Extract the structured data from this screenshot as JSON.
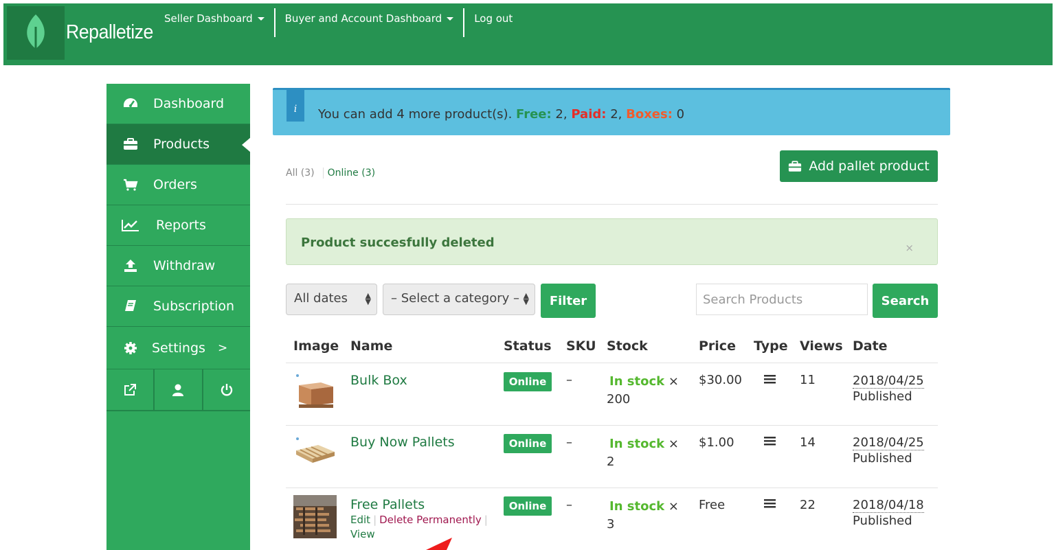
{
  "brand": "Repalletize",
  "topnav": {
    "seller": "Seller Dashboard",
    "buyer": "Buyer and Account Dashboard",
    "logout": "Log out"
  },
  "sidebar": {
    "items": [
      {
        "label": "Dashboard",
        "icon": "tachometer-icon"
      },
      {
        "label": "Products",
        "icon": "briefcase-icon"
      },
      {
        "label": "Orders",
        "icon": "cart-icon"
      },
      {
        "label": "Reports",
        "icon": "line-chart-icon"
      },
      {
        "label": "Withdraw",
        "icon": "upload-icon"
      },
      {
        "label": "Subscription",
        "icon": "book-icon"
      },
      {
        "label": "Settings",
        "icon": "gear-icon",
        "arrow": ">"
      }
    ]
  },
  "info": {
    "badge": "i",
    "prefix": "You can add 4 more product(s).",
    "free_label": "Free:",
    "free_value": "2,",
    "paid_label": "Paid:",
    "paid_value": "2,",
    "boxes_label": "Boxes:",
    "boxes_value": "0"
  },
  "tabs": {
    "all": "All (3)",
    "online": "Online (3)"
  },
  "add_button": "Add pallet product",
  "alert": {
    "message": "Product succesfully deleted",
    "close": "×"
  },
  "filters": {
    "dates": "All dates",
    "category": "– Select a category –",
    "filter_button": "Filter",
    "search_placeholder": "Search Products",
    "search_button": "Search"
  },
  "table": {
    "headers": {
      "image": "Image",
      "name": "Name",
      "status": "Status",
      "sku": "SKU",
      "stock": "Stock",
      "price": "Price",
      "type": "Type",
      "views": "Views",
      "date": "Date"
    },
    "rows": [
      {
        "name": "Bulk Box",
        "status": "Online",
        "sku": "–",
        "stock_label": "In stock",
        "stock_x": "×",
        "stock_qty": "200",
        "price": "$30.00",
        "views": "11",
        "date": "2018/04/25",
        "state": "Published"
      },
      {
        "name": "Buy Now Pallets",
        "status": "Online",
        "sku": "–",
        "stock_label": "In stock",
        "stock_x": "×",
        "stock_qty": "2",
        "price": "$1.00",
        "views": "14",
        "date": "2018/04/25",
        "state": "Published"
      },
      {
        "name": "Free Pallets",
        "status": "Online",
        "sku": "–",
        "stock_label": "In stock",
        "stock_x": "×",
        "stock_qty": "3",
        "price": "Free",
        "views": "22",
        "date": "2018/04/18",
        "state": "Published"
      }
    ],
    "row_actions": {
      "edit": "Edit",
      "delete": "Delete Permanently",
      "view": "View",
      "sep": "|"
    }
  }
}
